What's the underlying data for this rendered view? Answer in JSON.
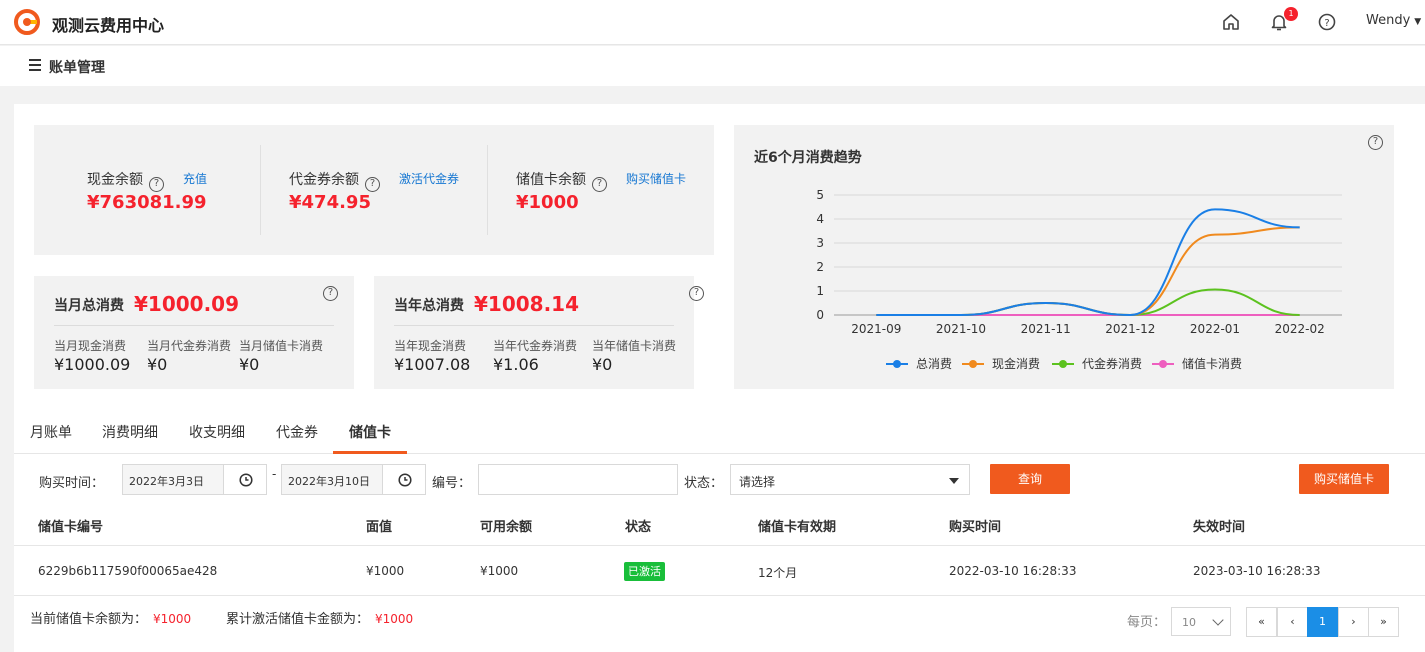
{
  "header": {
    "app_title": "观测云费用中心",
    "username": "Wendy",
    "notification_count": "1"
  },
  "subheader": {
    "title": "账单管理"
  },
  "balances": {
    "cash": {
      "label": "现金余额",
      "action": "充值",
      "value": "¥763081.99"
    },
    "voucher": {
      "label": "代金券余额",
      "action": "激活代金券",
      "value": "¥474.95"
    },
    "card": {
      "label": "储值卡余额",
      "action": "购买储值卡",
      "value": "¥1000"
    }
  },
  "monthly": {
    "title": "当月总消费",
    "total": "¥1000.09",
    "items": [
      {
        "label": "当月现金消费",
        "value": "¥1000.09"
      },
      {
        "label": "当月代金券消费",
        "value": "¥0"
      },
      {
        "label": "当月储值卡消费",
        "value": "¥0"
      }
    ]
  },
  "yearly": {
    "title": "当年总消费",
    "total": "¥1008.14",
    "items": [
      {
        "label": "当年现金消费",
        "value": "¥1007.08"
      },
      {
        "label": "当年代金券消费",
        "value": "¥1.06"
      },
      {
        "label": "当年储值卡消费",
        "value": "¥0"
      }
    ]
  },
  "chart_data": {
    "type": "line",
    "title": "近6个月消费趋势",
    "x": [
      "2021-09",
      "2021-10",
      "2021-11",
      "2021-12",
      "2022-01",
      "2022-02"
    ],
    "ylim": [
      0,
      5
    ],
    "yticks": [
      0,
      1,
      2,
      3,
      4,
      5
    ],
    "grid": true,
    "legend_position": "bottom",
    "series": [
      {
        "name": "总消费",
        "color": "#1a7fe6",
        "values": [
          0,
          0,
          0.5,
          0,
          4.4,
          3.65
        ]
      },
      {
        "name": "现金消费",
        "color": "#f08a1e",
        "values": [
          0,
          0,
          0.5,
          0,
          3.35,
          3.65
        ]
      },
      {
        "name": "代金券消费",
        "color": "#5cc21f",
        "values": [
          0,
          0,
          0.5,
          0,
          1.06,
          0
        ]
      },
      {
        "name": "储值卡消费",
        "color": "#ee5fbf",
        "values": [
          0,
          0,
          0,
          0,
          0,
          0
        ]
      }
    ]
  },
  "tabs": [
    "月账单",
    "消费明细",
    "收支明细",
    "代金券",
    "储值卡"
  ],
  "active_tab": "储值卡",
  "filters": {
    "purchase_time_label": "购买时间：",
    "date_from": "2022年3月3日",
    "date_to": "2022年3月10日",
    "date_separator": "-",
    "number_label": "编号：",
    "number_value": "",
    "status_label": "状态：",
    "status_placeholder": "请选择",
    "query_button": "查询",
    "buy_button": "购买储值卡"
  },
  "table": {
    "columns": [
      "储值卡编号",
      "面值",
      "可用余额",
      "状态",
      "储值卡有效期",
      "购买时间",
      "失效时间"
    ],
    "rows": [
      {
        "id": "6229b6b117590f00065ae428",
        "face_value": "¥1000",
        "available": "¥1000",
        "status": "已激活",
        "validity": "12个月",
        "purchase_time": "2022-03-10 16:28:33",
        "expire_time": "2023-03-10 16:28:33"
      }
    ]
  },
  "summary": {
    "current_label": "当前储值卡余额为：",
    "current_value": "¥1000",
    "activated_label": "累计激活储值卡金额为：",
    "activated_value": "¥1000"
  },
  "pagination": {
    "per_page_label": "每页：",
    "per_page": "10",
    "first": "«",
    "prev": "‹",
    "current": "1",
    "next": "›",
    "last": "»"
  }
}
